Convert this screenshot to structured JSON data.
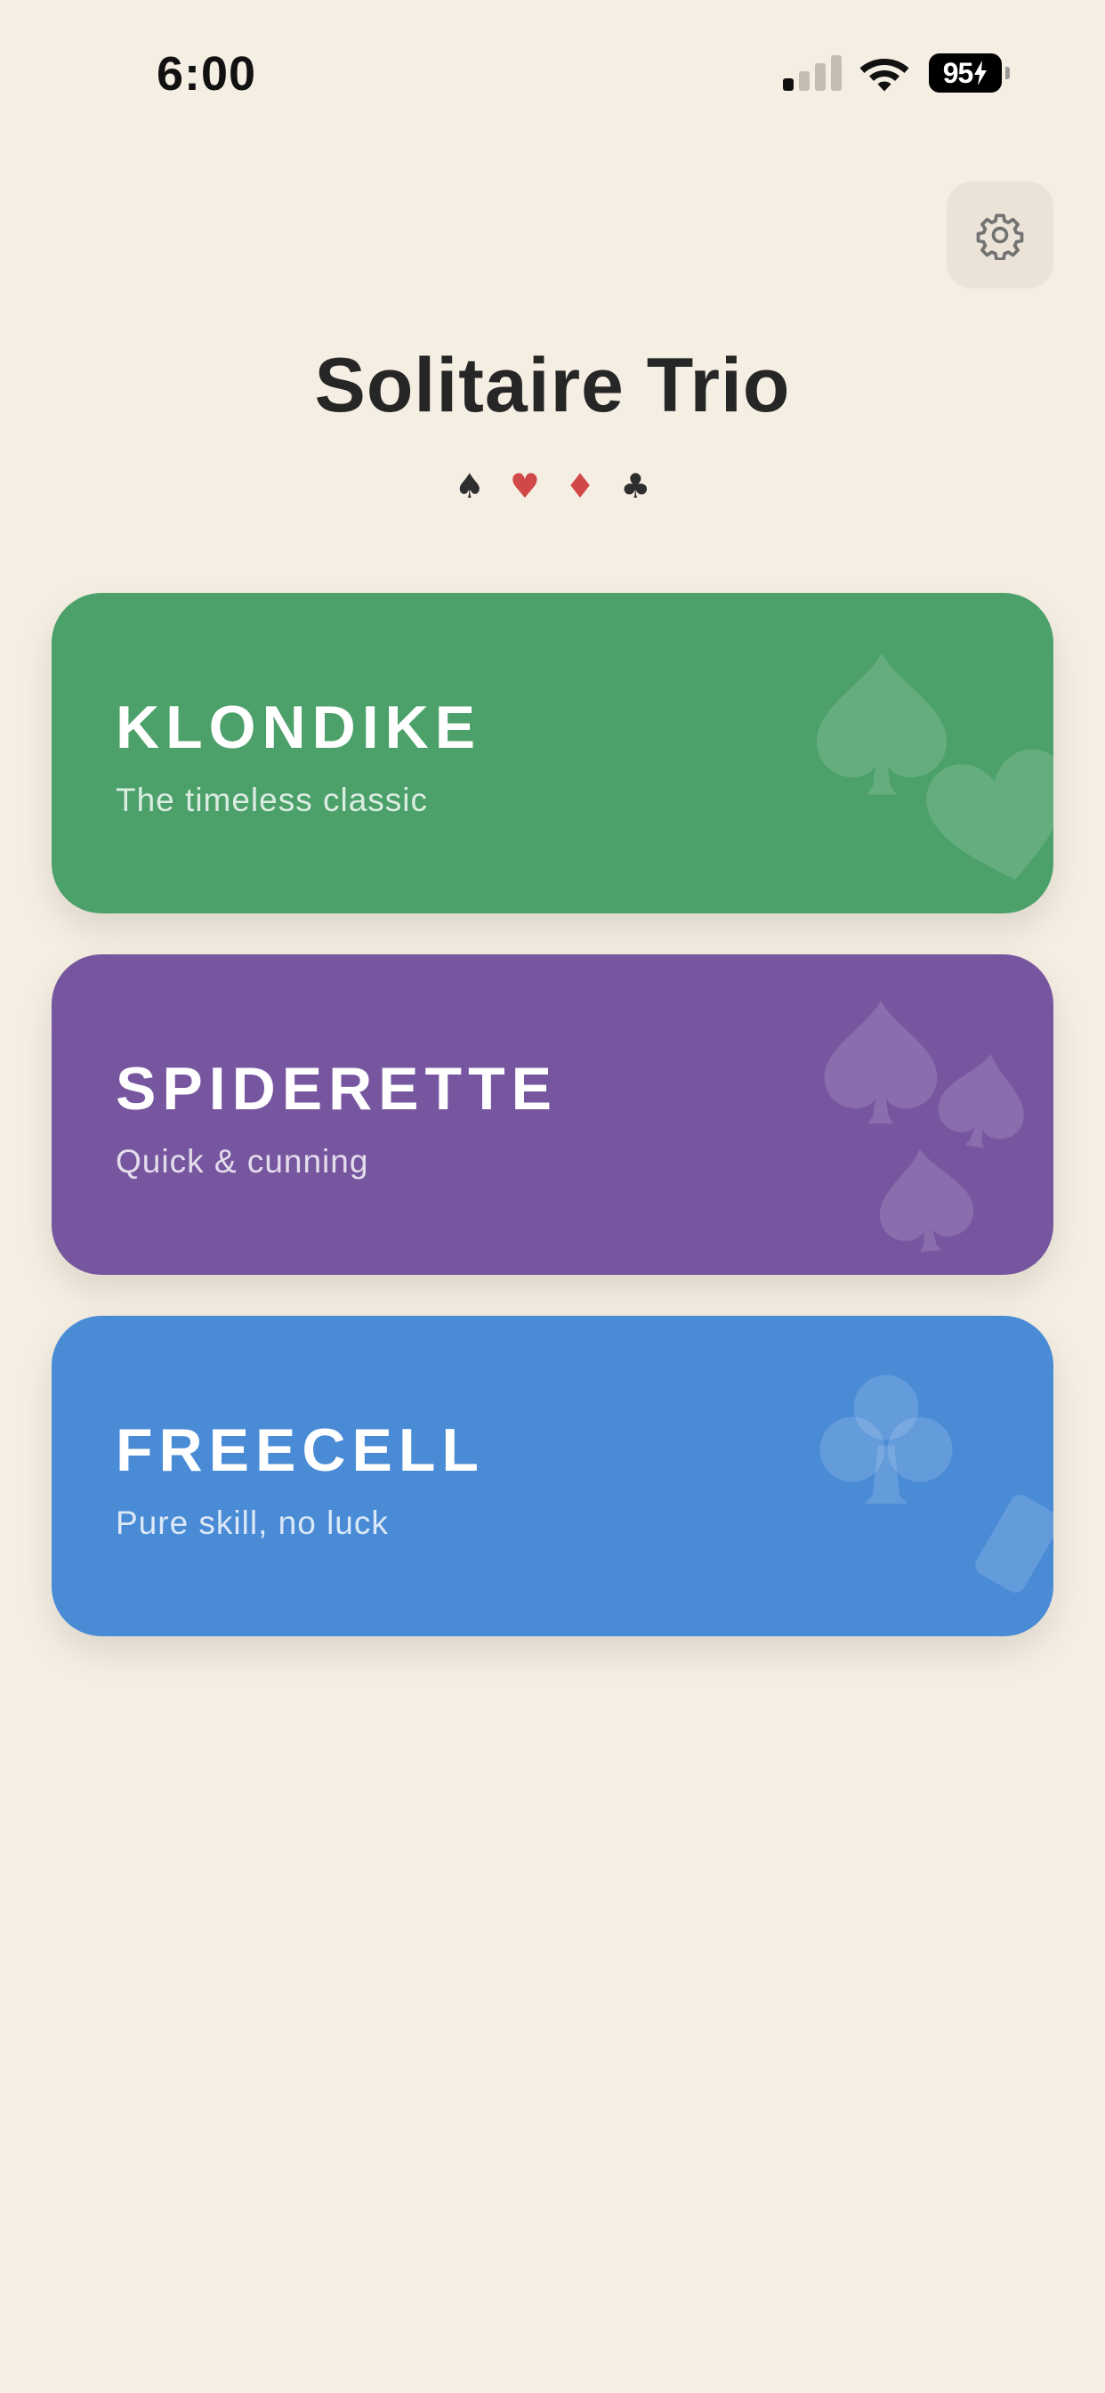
{
  "status_bar": {
    "time": "6:00",
    "battery": "95"
  },
  "header": {
    "title": "Solitaire Trio",
    "suits": [
      {
        "symbol": "♠",
        "color": "#2E2E2E"
      },
      {
        "symbol": "♥",
        "color": "#D04848"
      },
      {
        "symbol": "♦",
        "color": "#D04848"
      },
      {
        "symbol": "♣",
        "color": "#2E2E2E"
      }
    ]
  },
  "settings": {
    "icon": "gear-icon"
  },
  "games": [
    {
      "name": "KLONDIKE",
      "description": "The timeless classic",
      "color": "#4CA06A"
    },
    {
      "name": "SPIDERETTE",
      "description": "Quick & cunning",
      "color": "#7756A0"
    },
    {
      "name": "FREECELL",
      "description": "Pure skill, no luck",
      "color": "#4A8BD6"
    }
  ],
  "colors": {
    "background": "#F5EEE2",
    "title": "#262626",
    "settings_bg": "#EBE3D7"
  }
}
